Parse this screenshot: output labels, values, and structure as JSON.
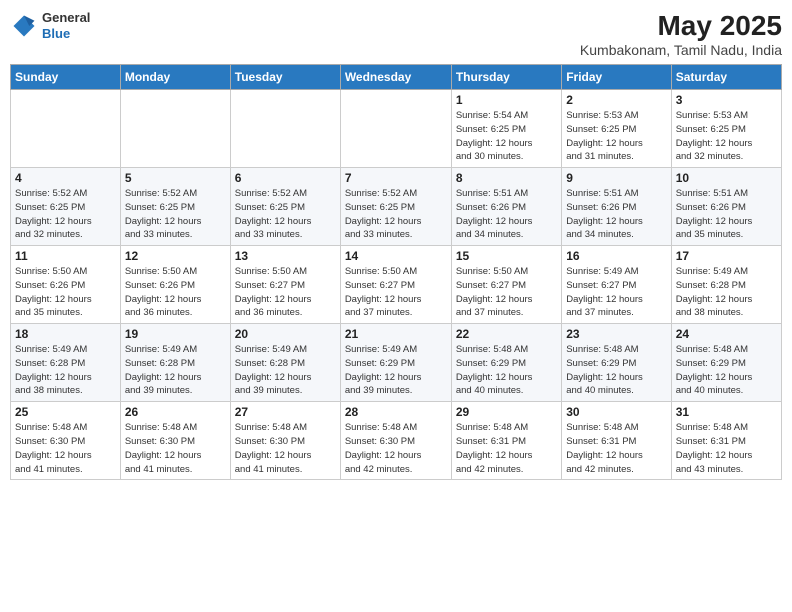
{
  "header": {
    "logo_general": "General",
    "logo_blue": "Blue",
    "month_title": "May 2025",
    "location": "Kumbakonam, Tamil Nadu, India"
  },
  "days_of_week": [
    "Sunday",
    "Monday",
    "Tuesday",
    "Wednesday",
    "Thursday",
    "Friday",
    "Saturday"
  ],
  "weeks": [
    [
      {
        "day": "",
        "info": ""
      },
      {
        "day": "",
        "info": ""
      },
      {
        "day": "",
        "info": ""
      },
      {
        "day": "",
        "info": ""
      },
      {
        "day": "1",
        "info": "Sunrise: 5:54 AM\nSunset: 6:25 PM\nDaylight: 12 hours\nand 30 minutes."
      },
      {
        "day": "2",
        "info": "Sunrise: 5:53 AM\nSunset: 6:25 PM\nDaylight: 12 hours\nand 31 minutes."
      },
      {
        "day": "3",
        "info": "Sunrise: 5:53 AM\nSunset: 6:25 PM\nDaylight: 12 hours\nand 32 minutes."
      }
    ],
    [
      {
        "day": "4",
        "info": "Sunrise: 5:52 AM\nSunset: 6:25 PM\nDaylight: 12 hours\nand 32 minutes."
      },
      {
        "day": "5",
        "info": "Sunrise: 5:52 AM\nSunset: 6:25 PM\nDaylight: 12 hours\nand 33 minutes."
      },
      {
        "day": "6",
        "info": "Sunrise: 5:52 AM\nSunset: 6:25 PM\nDaylight: 12 hours\nand 33 minutes."
      },
      {
        "day": "7",
        "info": "Sunrise: 5:52 AM\nSunset: 6:25 PM\nDaylight: 12 hours\nand 33 minutes."
      },
      {
        "day": "8",
        "info": "Sunrise: 5:51 AM\nSunset: 6:26 PM\nDaylight: 12 hours\nand 34 minutes."
      },
      {
        "day": "9",
        "info": "Sunrise: 5:51 AM\nSunset: 6:26 PM\nDaylight: 12 hours\nand 34 minutes."
      },
      {
        "day": "10",
        "info": "Sunrise: 5:51 AM\nSunset: 6:26 PM\nDaylight: 12 hours\nand 35 minutes."
      }
    ],
    [
      {
        "day": "11",
        "info": "Sunrise: 5:50 AM\nSunset: 6:26 PM\nDaylight: 12 hours\nand 35 minutes."
      },
      {
        "day": "12",
        "info": "Sunrise: 5:50 AM\nSunset: 6:26 PM\nDaylight: 12 hours\nand 36 minutes."
      },
      {
        "day": "13",
        "info": "Sunrise: 5:50 AM\nSunset: 6:27 PM\nDaylight: 12 hours\nand 36 minutes."
      },
      {
        "day": "14",
        "info": "Sunrise: 5:50 AM\nSunset: 6:27 PM\nDaylight: 12 hours\nand 37 minutes."
      },
      {
        "day": "15",
        "info": "Sunrise: 5:50 AM\nSunset: 6:27 PM\nDaylight: 12 hours\nand 37 minutes."
      },
      {
        "day": "16",
        "info": "Sunrise: 5:49 AM\nSunset: 6:27 PM\nDaylight: 12 hours\nand 37 minutes."
      },
      {
        "day": "17",
        "info": "Sunrise: 5:49 AM\nSunset: 6:28 PM\nDaylight: 12 hours\nand 38 minutes."
      }
    ],
    [
      {
        "day": "18",
        "info": "Sunrise: 5:49 AM\nSunset: 6:28 PM\nDaylight: 12 hours\nand 38 minutes."
      },
      {
        "day": "19",
        "info": "Sunrise: 5:49 AM\nSunset: 6:28 PM\nDaylight: 12 hours\nand 39 minutes."
      },
      {
        "day": "20",
        "info": "Sunrise: 5:49 AM\nSunset: 6:28 PM\nDaylight: 12 hours\nand 39 minutes."
      },
      {
        "day": "21",
        "info": "Sunrise: 5:49 AM\nSunset: 6:29 PM\nDaylight: 12 hours\nand 39 minutes."
      },
      {
        "day": "22",
        "info": "Sunrise: 5:48 AM\nSunset: 6:29 PM\nDaylight: 12 hours\nand 40 minutes."
      },
      {
        "day": "23",
        "info": "Sunrise: 5:48 AM\nSunset: 6:29 PM\nDaylight: 12 hours\nand 40 minutes."
      },
      {
        "day": "24",
        "info": "Sunrise: 5:48 AM\nSunset: 6:29 PM\nDaylight: 12 hours\nand 40 minutes."
      }
    ],
    [
      {
        "day": "25",
        "info": "Sunrise: 5:48 AM\nSunset: 6:30 PM\nDaylight: 12 hours\nand 41 minutes."
      },
      {
        "day": "26",
        "info": "Sunrise: 5:48 AM\nSunset: 6:30 PM\nDaylight: 12 hours\nand 41 minutes."
      },
      {
        "day": "27",
        "info": "Sunrise: 5:48 AM\nSunset: 6:30 PM\nDaylight: 12 hours\nand 41 minutes."
      },
      {
        "day": "28",
        "info": "Sunrise: 5:48 AM\nSunset: 6:30 PM\nDaylight: 12 hours\nand 42 minutes."
      },
      {
        "day": "29",
        "info": "Sunrise: 5:48 AM\nSunset: 6:31 PM\nDaylight: 12 hours\nand 42 minutes."
      },
      {
        "day": "30",
        "info": "Sunrise: 5:48 AM\nSunset: 6:31 PM\nDaylight: 12 hours\nand 42 minutes."
      },
      {
        "day": "31",
        "info": "Sunrise: 5:48 AM\nSunset: 6:31 PM\nDaylight: 12 hours\nand 43 minutes."
      }
    ]
  ]
}
